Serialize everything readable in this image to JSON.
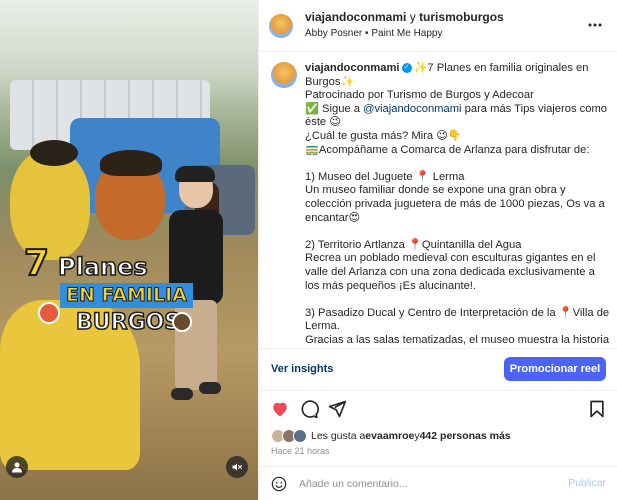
{
  "header": {
    "user1": "viajandoconmami",
    "and_word": "y",
    "user2": "turismoburgos",
    "audio_artist": "Abby Posner",
    "audio_separator": "•",
    "audio_title": "Paint Me Happy",
    "more_icon": "more-horizontal-icon"
  },
  "media": {
    "overlay": {
      "number": "7",
      "word1": "Planes",
      "word2": "EN FAMILIA",
      "word3": "BURGOS"
    },
    "tag_icon": "user-tag-icon",
    "mute_icon": "speaker-muted-icon"
  },
  "caption": {
    "username": "viajandoconmami",
    "line1": "✨7 Planes en familia originales en Burgos✨",
    "line2": "Patrocinado por Turismo de Burgos y Adecoar",
    "line3_prefix": "✅ Sigue a ",
    "line3_mention": "@viajandoconmami",
    "line3_suffix": " para más Tips viajeros como éste 😉",
    "line4": "¿Cuál te gusta más? Mira 😉👇",
    "line5": "🚃Acompáñame a Comarca de Arlanza para disfrutar de:",
    "item1_title": "1) Museo del Juguete 📍 Lerma",
    "item1_text": "Un museo familiar donde se expone una gran obra y colección privada juguetera de más de 1000 piezas, Os va a encantar😍",
    "item2_title": "2) Territorio Artlanza 📍Quintanilla del Agua",
    "item2_text": "Recrea un poblado medieval con esculturas gigantes en el valle del Arlanza con una zona dedicada exclusivamente a los más pequeños ¡Es alucinante!.",
    "item3_title": "3) Pasadizo Ducal y Centro de Interpretación de la 📍Villa de Lerma.",
    "item3_text": "Gracias a las salas tematizadas, el museo muestra la historia de Lerma al igual que sus misteriosos pasadizos."
  },
  "insights": {
    "link": "Ver insights",
    "promote": "Promocionar reel"
  },
  "actions": {
    "like_icon": "heart-filled-icon",
    "comment_icon": "comment-icon",
    "share_icon": "share-icon",
    "save_icon": "bookmark-icon",
    "like_color": "#ed4956"
  },
  "likes": {
    "prefix": "Les gusta a ",
    "user": "evaamroe",
    "middle": " y ",
    "count": "442 personas más"
  },
  "time_ago": "Hace 21 horas",
  "comment": {
    "placeholder": "Añade un comentario...",
    "publish": "Publicar",
    "emoji_icon": "emoji-icon"
  },
  "colors": {
    "accent": "#4c64f5",
    "link": "#00376b",
    "verified": "#0095f6"
  }
}
